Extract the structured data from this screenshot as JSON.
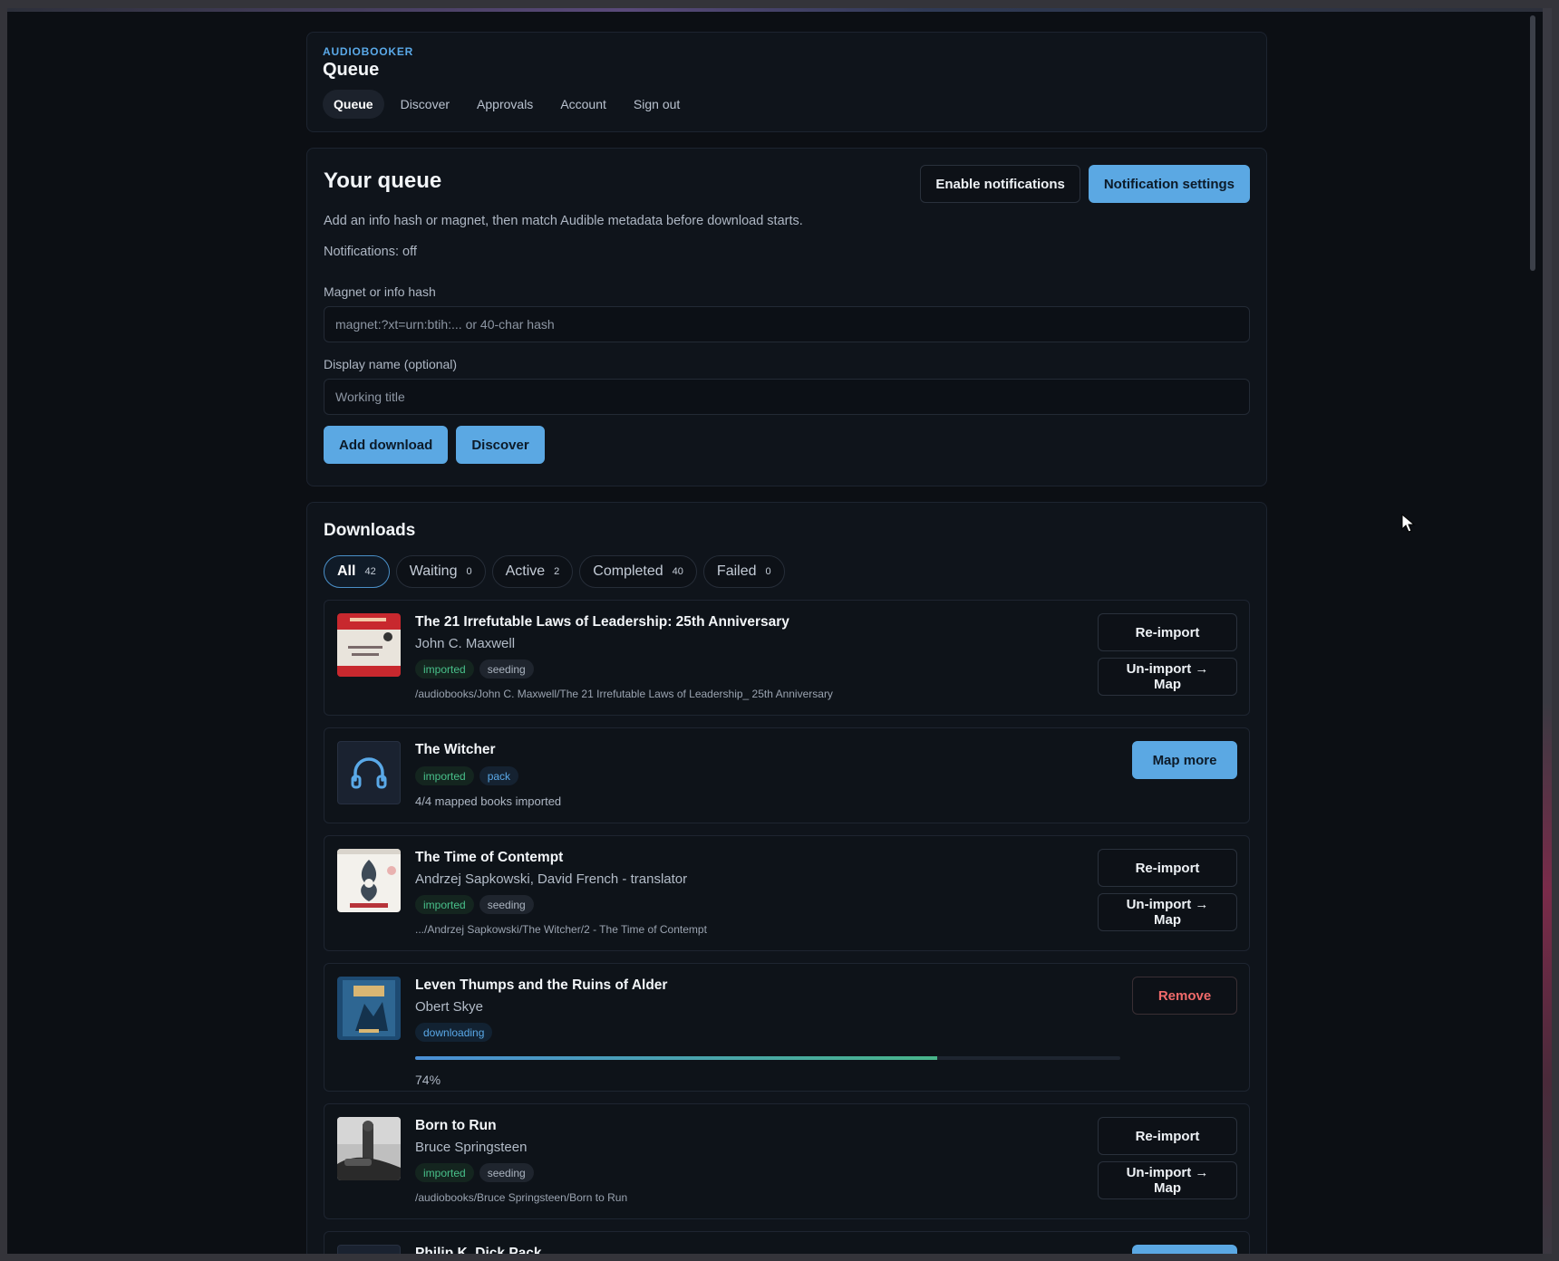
{
  "header": {
    "brand": "AUDIOBOOKER",
    "title": "Queue",
    "nav": [
      {
        "label": "Queue",
        "active": true
      },
      {
        "label": "Discover"
      },
      {
        "label": "Approvals"
      },
      {
        "label": "Account"
      },
      {
        "label": "Sign out"
      }
    ]
  },
  "queue": {
    "title": "Your queue",
    "enable_notifications_label": "Enable notifications",
    "notification_settings_label": "Notification settings",
    "description": "Add an info hash or magnet, then match Audible metadata before download starts.",
    "notifications_status": "Notifications: off",
    "magnet_label": "Magnet or info hash",
    "magnet_placeholder": "magnet:?xt=urn:btih:... or 40-char hash",
    "display_name_label": "Display name (optional)",
    "display_name_placeholder": "Working title",
    "add_download_label": "Add download",
    "discover_label": "Discover"
  },
  "downloads": {
    "title": "Downloads",
    "filters": [
      {
        "label": "All",
        "count": "42",
        "active": true
      },
      {
        "label": "Waiting",
        "count": "0"
      },
      {
        "label": "Active",
        "count": "2"
      },
      {
        "label": "Completed",
        "count": "40"
      },
      {
        "label": "Failed",
        "count": "0"
      }
    ],
    "items": [
      {
        "title": "The 21 Irrefutable Laws of Leadership: 25th Anniversary",
        "author": "John C. Maxwell",
        "tags": [
          "imported",
          "seeding"
        ],
        "path": "/audiobooks/John C. Maxwell/The 21 Irrefutable Laws of Leadership_ 25th Anniversary",
        "actions": [
          "Re-import",
          "Un-import → Map"
        ]
      },
      {
        "title": "The Witcher",
        "tags": [
          "imported",
          "pack"
        ],
        "note": "4/4 mapped books imported",
        "actions": [
          "Map more"
        ]
      },
      {
        "title": "The Time of Contempt",
        "author": "Andrzej Sapkowski, David French - translator",
        "tags": [
          "imported",
          "seeding"
        ],
        "path": ".../Andrzej Sapkowski/The Witcher/2 - The Time of Contempt",
        "actions": [
          "Re-import",
          "Un-import → Map"
        ]
      },
      {
        "title": "Leven Thumps and the Ruins of Alder",
        "author": "Obert Skye",
        "tags": [
          "downloading"
        ],
        "progress": 0.74,
        "progress_label": "74%",
        "actions": [
          "Remove"
        ]
      },
      {
        "title": "Born to Run",
        "author": "Bruce Springsteen",
        "tags": [
          "imported",
          "seeding"
        ],
        "path": "/audiobooks/Bruce Springsteen/Born to Run",
        "actions": [
          "Re-import",
          "Un-import → Map"
        ]
      },
      {
        "title": "Philip K. Dick Pack"
      }
    ]
  },
  "colors": {
    "accent": "#5ba8e3",
    "imported": "#48c08a",
    "danger": "#f06a6a",
    "background": "#0c0f14"
  },
  "icons": {
    "pack_cover": "headphones-icon",
    "cursor": "mouse-pointer-icon"
  }
}
